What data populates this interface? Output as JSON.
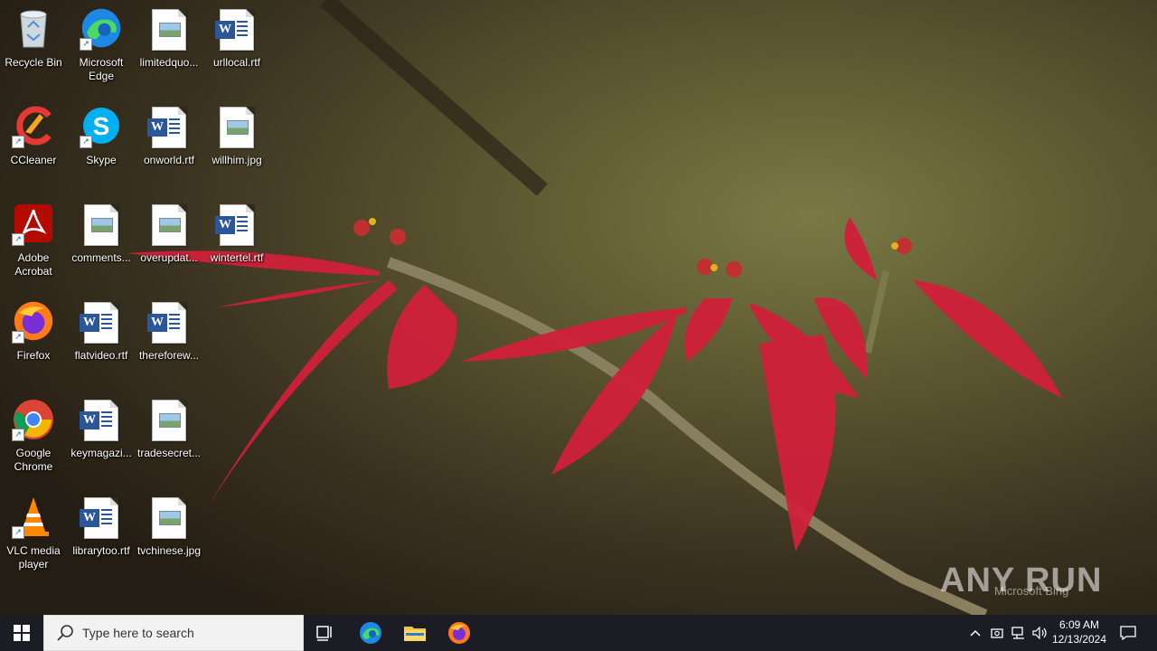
{
  "desktop": {
    "icons": [
      {
        "label": "Recycle Bin",
        "kind": "recycle-bin-icon",
        "shortcut": false
      },
      {
        "label": "Microsoft Edge",
        "kind": "edge-icon",
        "shortcut": true
      },
      {
        "label": "limitedquo...",
        "kind": "image-file-icon",
        "shortcut": false
      },
      {
        "label": "urllocal.rtf",
        "kind": "word-doc-icon",
        "shortcut": false
      },
      {
        "label": "CCleaner",
        "kind": "ccleaner-icon",
        "shortcut": true
      },
      {
        "label": "Skype",
        "kind": "skype-icon",
        "shortcut": true
      },
      {
        "label": "onworld.rtf",
        "kind": "word-doc-icon",
        "shortcut": false
      },
      {
        "label": "willhim.jpg",
        "kind": "image-file-icon",
        "shortcut": false
      },
      {
        "label": "Adobe Acrobat",
        "kind": "acrobat-icon",
        "shortcut": true
      },
      {
        "label": "comments...",
        "kind": "image-file-icon",
        "shortcut": false
      },
      {
        "label": "overupdat...",
        "kind": "image-file-icon",
        "shortcut": false
      },
      {
        "label": "wintertel.rtf",
        "kind": "word-doc-icon",
        "shortcut": false
      },
      {
        "label": "Firefox",
        "kind": "firefox-icon",
        "shortcut": true
      },
      {
        "label": "flatvideo.rtf",
        "kind": "word-doc-icon",
        "shortcut": false
      },
      {
        "label": "thereforew...",
        "kind": "word-doc-icon",
        "shortcut": false
      },
      {
        "label": "Google Chrome",
        "kind": "chrome-icon",
        "shortcut": true
      },
      {
        "label": "keymagazi...",
        "kind": "word-doc-icon",
        "shortcut": false
      },
      {
        "label": "tradesecret...",
        "kind": "image-file-icon",
        "shortcut": false
      },
      {
        "label": "VLC media player",
        "kind": "vlc-icon",
        "shortcut": true
      },
      {
        "label": "librarytoo.rtf",
        "kind": "word-doc-icon",
        "shortcut": false
      },
      {
        "label": "tvchinese.jpg",
        "kind": "image-file-icon",
        "shortcut": false
      }
    ]
  },
  "taskbar": {
    "search_placeholder": "Type here to search",
    "clock": {
      "time": "6:09 AM",
      "date": "12/13/2024"
    }
  },
  "watermark": {
    "text": "ANY RUN",
    "bing": "Microsoft Bing"
  },
  "colors": {
    "taskbar": "#1c1c24",
    "search_bg": "#f2f2f2",
    "word_blue": "#2b579a",
    "leaf_red": "#d0203a"
  }
}
